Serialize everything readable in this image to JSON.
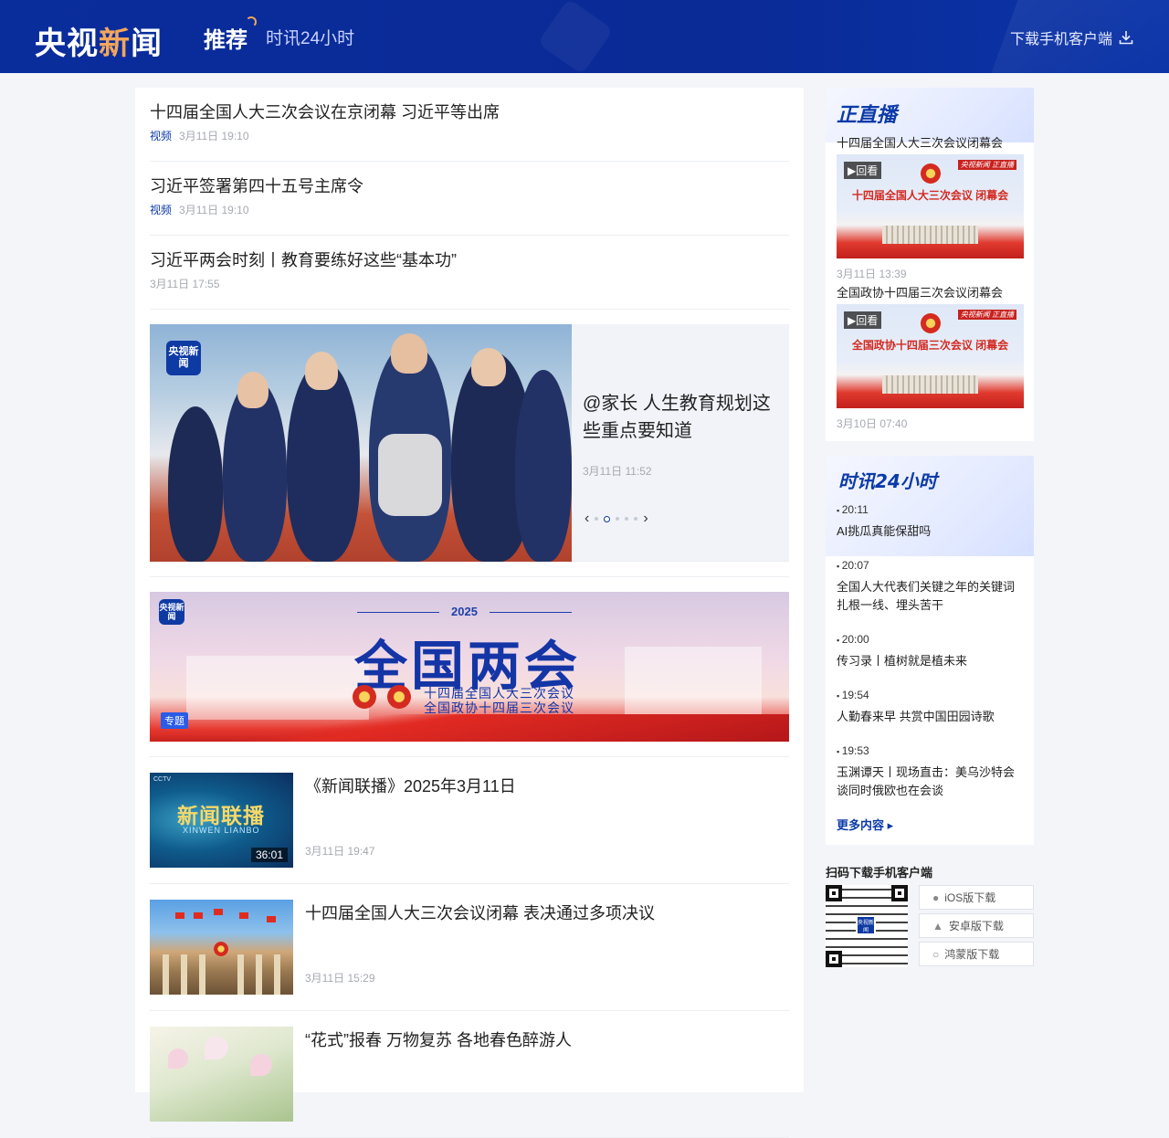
{
  "header": {
    "logo_prefix": "央视",
    "logo_highlight": "新",
    "logo_suffix": "闻",
    "tab_recommend": "推荐",
    "tab_24h": "时讯24小时",
    "download_app": "下载手机客户端"
  },
  "news_list": [
    {
      "title": "十四届全国人大三次会议在京闭幕 习近平等出席",
      "tag": "视频",
      "time": "3月11日 19:10"
    },
    {
      "title": "习近平签署第四十五号主席令",
      "tag": "视频",
      "time": "3月11日 19:10"
    },
    {
      "title": "习近平两会时刻丨教育要练好这些“基本功”",
      "tag": "",
      "time": "3月11日 17:55"
    }
  ],
  "carousel": {
    "badge": "央视新闻",
    "title": "@家长 人生教育规划这些重点要知道",
    "time": "3月11日 11:52",
    "prev": "‹",
    "next": "›",
    "active_index": 1,
    "count": 5
  },
  "banner": {
    "badge": "央视新闻",
    "year": "2025",
    "title": "全国两会",
    "sub1": "十四届全国人大三次会议",
    "sub2": "全国政协十四届三次会议",
    "tag": "专题"
  },
  "video_list": [
    {
      "title": "《新闻联播》2025年3月11日",
      "time": "3月11日 19:47",
      "thumb_title": "新闻联播",
      "thumb_sub": "XINWEN LIANBO",
      "thumb_logo": "CCTV",
      "duration": "36:01"
    },
    {
      "title": "十四届全国人大三次会议闭幕 表决通过多项决议",
      "time": "3月11日 15:29"
    },
    {
      "title": "“花式”报春 万物复苏 各地春色醉游人",
      "time": ""
    }
  ],
  "live": {
    "title": "正直播",
    "events": [
      {
        "name": "十四届全国人大三次会议闭幕会",
        "badge": "▶回看",
        "thumb_text": "十四届全国人大三次会议 闭幕会",
        "tag": "央视新闻 正直播",
        "time": "3月11日 13:39"
      },
      {
        "name": "全国政协十四届三次会议闭幕会",
        "badge": "▶回看",
        "thumb_text": "全国政协十四届三次会议 闭幕会",
        "tag": "央视新闻 正直播",
        "time": "3月10日 07:40"
      }
    ]
  },
  "h24": {
    "title": "时讯24小时",
    "items": [
      {
        "time": "20:11",
        "text": "AI挑瓜真能保甜吗"
      },
      {
        "time": "20:07",
        "text": "全国人大代表们关键之年的关键词 扎根一线、埋头苦干"
      },
      {
        "time": "20:00",
        "text": "传习录丨植树就是植未来"
      },
      {
        "time": "19:54",
        "text": "人勤春来早 共赏中国田园诗歌"
      },
      {
        "time": "19:53",
        "text": "玉渊谭天丨现场直击：美乌沙特会谈同时俄欧也在会谈"
      }
    ],
    "more": "更多内容 ▸"
  },
  "download": {
    "title": "扫码下载手机客户端",
    "qr_logo": "央视新闻",
    "buttons": [
      {
        "label": "iOS版下载",
        "icon": "apple-icon"
      },
      {
        "label": "安卓版下载",
        "icon": "android-icon"
      },
      {
        "label": "鸿蒙版下载",
        "icon": "harmony-icon"
      }
    ]
  }
}
